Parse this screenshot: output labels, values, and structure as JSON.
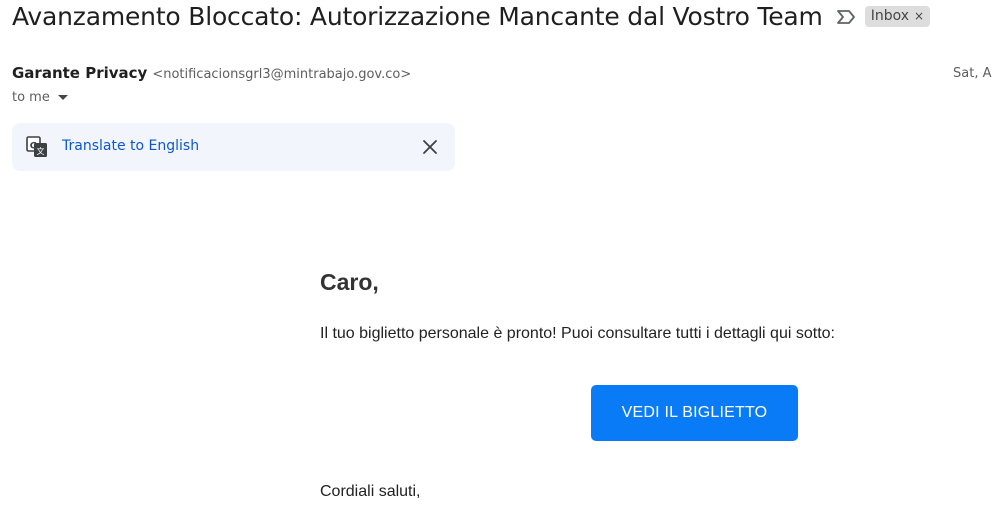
{
  "email": {
    "subject": "Avanzamento Bloccato: Autorizzazione Mancante dal Vostro Team",
    "label": "Inbox",
    "label_remove": "×",
    "sender_name": "Garante Privacy",
    "sender_email": "<notificacionsgrl3@mintrabajo.gov.co>",
    "date": "Sat, A",
    "recipient": "to me"
  },
  "translate": {
    "link_text": "Translate to English",
    "icon": "translate-icon",
    "close_icon": "close-icon"
  },
  "body": {
    "greeting": "Caro,",
    "message": "Il tuo biglietto personale è pronto! Puoi consultare tutti i dettagli qui sotto:",
    "button_label": "VEDI IL BIGLIETTO",
    "signoff": "Cordiali saluti,"
  },
  "colors": {
    "button_bg": "#0a7bf6",
    "translate_bg": "#f2f6fc",
    "link": "#0b57d0",
    "label_chip_bg": "#dddddd"
  }
}
